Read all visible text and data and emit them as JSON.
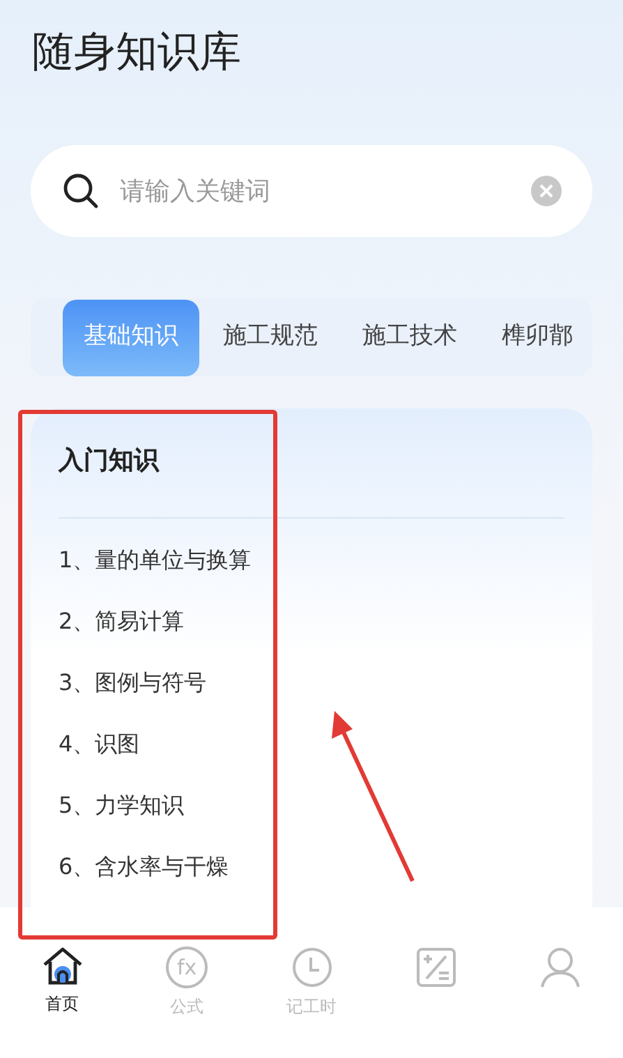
{
  "app_title": "随身知识库",
  "search": {
    "placeholder": "请输入关键词"
  },
  "categories": [
    {
      "label": "基础知识",
      "selected": true
    },
    {
      "label": "施工规范",
      "selected": false
    },
    {
      "label": "施工技术",
      "selected": false
    },
    {
      "label": "榫卯鄁",
      "selected": false
    }
  ],
  "section": {
    "title": "入门知识",
    "items": [
      "1、量的单位与换算",
      "2、简易计算",
      "3、图例与符号",
      "4、识图",
      "5、力学知识",
      "6、含水率与干燥"
    ]
  },
  "bottom_nav": [
    {
      "kind": "home",
      "label": "首页",
      "selected": true
    },
    {
      "kind": "formula",
      "glyph": "fx",
      "label": "公式",
      "selected": false
    },
    {
      "kind": "clock",
      "label": "记工时",
      "selected": false
    },
    {
      "kind": "calculator",
      "selected": false
    },
    {
      "kind": "profile",
      "selected": false
    }
  ]
}
